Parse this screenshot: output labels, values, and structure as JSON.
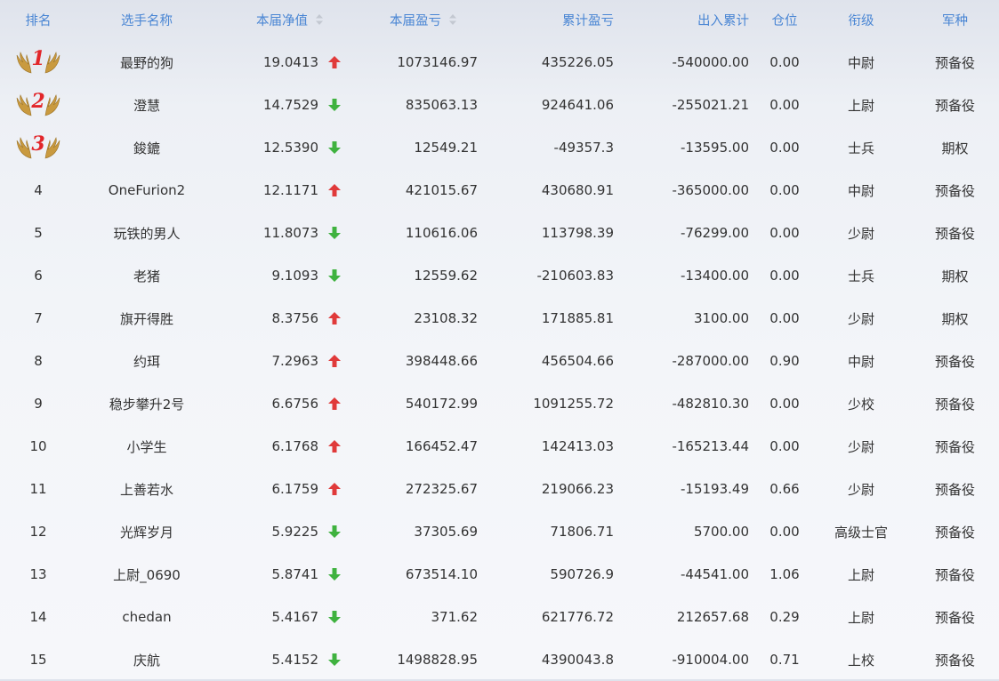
{
  "header": {
    "rank": "排名",
    "name": "选手名称",
    "nav": "本届净值",
    "pnl": "本届盈亏",
    "cum_pnl": "累计盈亏",
    "cum_flow": "出入累计",
    "position": "仓位",
    "grade": "衔级",
    "corps": "军种"
  },
  "colors": {
    "header_text": "#4a86d4",
    "up_arrow": "#e03a3a",
    "down_arrow": "#3fb23f",
    "medal_number": "#e2262a",
    "medal_wing": "#c99a3f"
  },
  "rows": [
    {
      "rank": "1",
      "medal": true,
      "name": "最野的狗",
      "nav": "19.0413",
      "trend": "up",
      "pnl": "1073146.97",
      "cum_pnl": "435226.05",
      "cum_flow": "-540000.00",
      "position": "0.00",
      "grade": "中尉",
      "corps": "预备役"
    },
    {
      "rank": "2",
      "medal": true,
      "name": "澄慧",
      "nav": "14.7529",
      "trend": "down",
      "pnl": "835063.13",
      "cum_pnl": "924641.06",
      "cum_flow": "-255021.21",
      "position": "0.00",
      "grade": "上尉",
      "corps": "预备役"
    },
    {
      "rank": "3",
      "medal": true,
      "name": "鋑鏕",
      "nav": "12.5390",
      "trend": "down",
      "pnl": "12549.21",
      "cum_pnl": "-49357.3",
      "cum_flow": "-13595.00",
      "position": "0.00",
      "grade": "士兵",
      "corps": "期权"
    },
    {
      "rank": "4",
      "medal": false,
      "name": "OneFurion2",
      "nav": "12.1171",
      "trend": "up",
      "pnl": "421015.67",
      "cum_pnl": "430680.91",
      "cum_flow": "-365000.00",
      "position": "0.00",
      "grade": "中尉",
      "corps": "预备役"
    },
    {
      "rank": "5",
      "medal": false,
      "name": "玩铁的男人",
      "nav": "11.8073",
      "trend": "down",
      "pnl": "110616.06",
      "cum_pnl": "113798.39",
      "cum_flow": "-76299.00",
      "position": "0.00",
      "grade": "少尉",
      "corps": "预备役"
    },
    {
      "rank": "6",
      "medal": false,
      "name": "老猪",
      "nav": "9.1093",
      "trend": "down",
      "pnl": "12559.62",
      "cum_pnl": "-210603.83",
      "cum_flow": "-13400.00",
      "position": "0.00",
      "grade": "士兵",
      "corps": "期权"
    },
    {
      "rank": "7",
      "medal": false,
      "name": "旗开得胜",
      "nav": "8.3756",
      "trend": "up",
      "pnl": "23108.32",
      "cum_pnl": "171885.81",
      "cum_flow": "3100.00",
      "position": "0.00",
      "grade": "少尉",
      "corps": "期权"
    },
    {
      "rank": "8",
      "medal": false,
      "name": "约珥",
      "nav": "7.2963",
      "trend": "up",
      "pnl": "398448.66",
      "cum_pnl": "456504.66",
      "cum_flow": "-287000.00",
      "position": "0.90",
      "grade": "中尉",
      "corps": "预备役"
    },
    {
      "rank": "9",
      "medal": false,
      "name": "稳步攀升2号",
      "nav": "6.6756",
      "trend": "up",
      "pnl": "540172.99",
      "cum_pnl": "1091255.72",
      "cum_flow": "-482810.30",
      "position": "0.00",
      "grade": "少校",
      "corps": "预备役"
    },
    {
      "rank": "10",
      "medal": false,
      "name": "小学生",
      "nav": "6.1768",
      "trend": "up",
      "pnl": "166452.47",
      "cum_pnl": "142413.03",
      "cum_flow": "-165213.44",
      "position": "0.00",
      "grade": "少尉",
      "corps": "预备役"
    },
    {
      "rank": "11",
      "medal": false,
      "name": "上善若水",
      "nav": "6.1759",
      "trend": "up",
      "pnl": "272325.67",
      "cum_pnl": "219066.23",
      "cum_flow": "-15193.49",
      "position": "0.66",
      "grade": "少尉",
      "corps": "预备役"
    },
    {
      "rank": "12",
      "medal": false,
      "name": "光辉岁月",
      "nav": "5.9225",
      "trend": "down",
      "pnl": "37305.69",
      "cum_pnl": "71806.71",
      "cum_flow": "5700.00",
      "position": "0.00",
      "grade": "高级士官",
      "corps": "预备役"
    },
    {
      "rank": "13",
      "medal": false,
      "name": "上尉_0690",
      "nav": "5.8741",
      "trend": "down",
      "pnl": "673514.10",
      "cum_pnl": "590726.9",
      "cum_flow": "-44541.00",
      "position": "1.06",
      "grade": "上尉",
      "corps": "预备役"
    },
    {
      "rank": "14",
      "medal": false,
      "name": "chedan",
      "nav": "5.4167",
      "trend": "down",
      "pnl": "371.62",
      "cum_pnl": "621776.72",
      "cum_flow": "212657.68",
      "position": "0.29",
      "grade": "上尉",
      "corps": "预备役"
    },
    {
      "rank": "15",
      "medal": false,
      "name": "庆航",
      "nav": "5.4152",
      "trend": "down",
      "pnl": "1498828.95",
      "cum_pnl": "4390043.8",
      "cum_flow": "-910004.00",
      "position": "0.71",
      "grade": "上校",
      "corps": "预备役"
    }
  ]
}
